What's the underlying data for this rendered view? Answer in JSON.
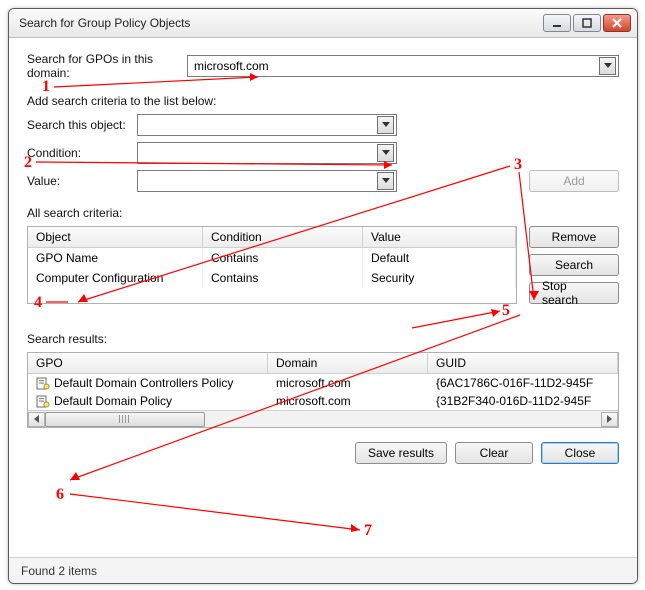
{
  "window": {
    "title": "Search for Group Policy Objects"
  },
  "domain_row": {
    "label": "Search for GPOs in this domain:",
    "value": "microsoft.com"
  },
  "criteria_intro": "Add search criteria to the list below:",
  "object_row": {
    "label": "Search this object:",
    "value": ""
  },
  "condition_row": {
    "label": "Condition:",
    "value": ""
  },
  "value_row": {
    "label": "Value:",
    "value": ""
  },
  "add_btn": "Add",
  "all_criteria_label": "All search criteria:",
  "criteria_headers": {
    "object": "Object",
    "condition": "Condition",
    "value": "Value"
  },
  "criteria_rows": [
    {
      "object": "GPO Name",
      "condition": "Contains",
      "value": "Default"
    },
    {
      "object": "Computer Configuration",
      "condition": "Contains",
      "value": "Security"
    }
  ],
  "remove_btn": "Remove",
  "search_btn": "Search",
  "stop_btn": "Stop search",
  "results_label": "Search results:",
  "results_headers": {
    "gpo": "GPO",
    "domain": "Domain",
    "guid": "GUID"
  },
  "results_rows": [
    {
      "gpo": "Default Domain Controllers Policy",
      "domain": "microsoft.com",
      "guid": "{6AC1786C-016F-11D2-945F"
    },
    {
      "gpo": "Default Domain Policy",
      "domain": "microsoft.com",
      "guid": "{31B2F340-016D-11D2-945F"
    }
  ],
  "save_btn": "Save results",
  "clear_btn": "Clear",
  "close_btn": "Close",
  "status": "Found 2 items",
  "annotations": {
    "1": "1",
    "2": "2",
    "3": "3",
    "4": "4",
    "5": "5",
    "6": "6",
    "7": "7"
  }
}
